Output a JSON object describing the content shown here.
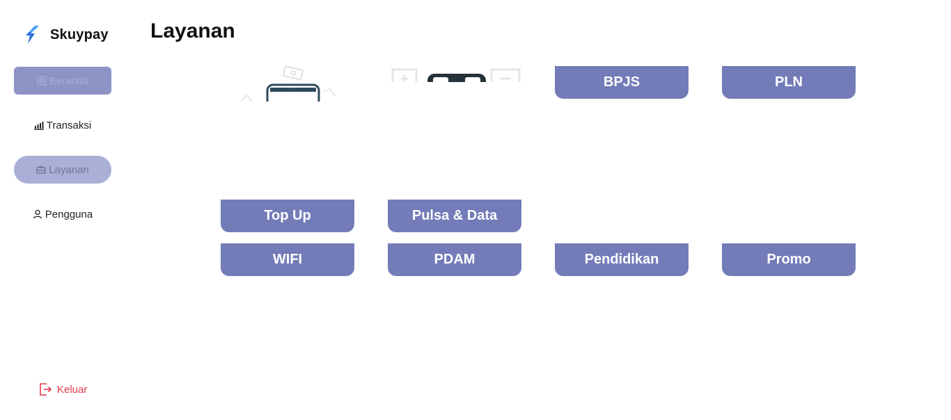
{
  "brand": {
    "name": "Skuypay"
  },
  "nav": {
    "items": [
      {
        "label": "Beranda",
        "icon": "grid-icon"
      },
      {
        "label": "Transaksi",
        "icon": "bar-chart-icon"
      },
      {
        "label": "Layanan",
        "icon": "toolbox-icon"
      },
      {
        "label": "Pengguna",
        "icon": "user-icon"
      }
    ],
    "active": "Layanan"
  },
  "logout": {
    "label": "Keluar",
    "icon": "logout-icon",
    "color": "#e4394b"
  },
  "page": {
    "title": "Layanan"
  },
  "services": [
    {
      "label": "BPJS"
    },
    {
      "label": "PLN"
    },
    {
      "label": "Top Up"
    },
    {
      "label": "Pulsa & Data"
    },
    {
      "label": "WIFI"
    },
    {
      "label": "PDAM"
    },
    {
      "label": "Pendidikan"
    },
    {
      "label": "Promo"
    }
  ],
  "colors": {
    "button": "#737cb8",
    "active_nav": "#a9afd6",
    "home_nav": "#8e93c6",
    "brand_blue": "#2a6fdb"
  }
}
